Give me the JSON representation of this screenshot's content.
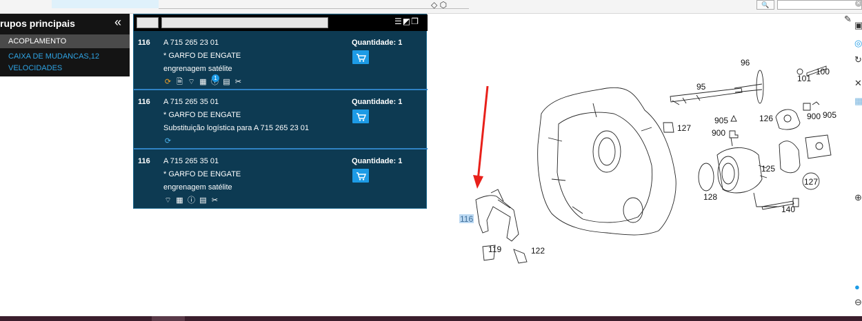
{
  "left_panel": {
    "title": "rupos principais",
    "collapse_icon": "double-chevron-left-icon",
    "items": [
      {
        "label": "ACOPLAMENTO"
      },
      {
        "label": "CAIXA DE MUDANCAS,12 VELOCIDADES"
      }
    ]
  },
  "parts_list": {
    "rows": [
      {
        "position": "116",
        "part_number": "A 715 265 23 01",
        "description": "* GARFO DE ENGATE",
        "info": "engrenagem satélite",
        "quantity_label": "Quantidade: 1",
        "badge": "1"
      },
      {
        "position": "116",
        "part_number": "A 715 265 35 01",
        "description": "* GARFO DE ENGATE",
        "info": "Substituição logística para A 715 265 23 01",
        "quantity_label": "Quantidade: 1"
      },
      {
        "position": "116",
        "part_number": "A 715 265 35 01",
        "description": "* GARFO DE ENGATE",
        "info": "engrenagem satélite",
        "quantity_label": "Quantidade: 1"
      }
    ]
  },
  "diagram": {
    "callouts": [
      "96",
      "95",
      "100",
      "101",
      "127",
      "905",
      "900",
      "126",
      "900",
      "905",
      "125",
      "128",
      "140",
      "127",
      "116",
      "119",
      "122"
    ],
    "highlighted": "116"
  },
  "colors": {
    "panel_bg": "#0d3a52",
    "row_separator": "#2f82c4",
    "cart_button": "#1d9be6",
    "arrow": "#e8201a",
    "highlight": "#bcd9f2",
    "left_link": "#2fa3e3"
  }
}
